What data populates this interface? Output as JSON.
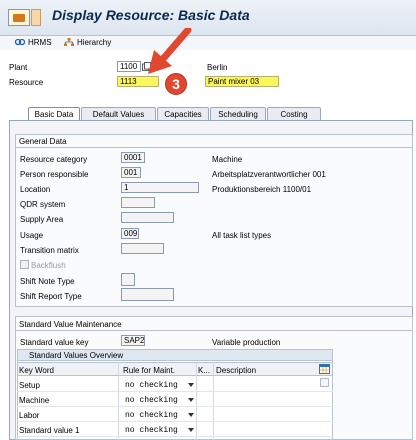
{
  "window": {
    "title": "Display Resource: Basic Data"
  },
  "toolbar": {
    "hrms_label": "HRMS",
    "hierarchy_label": "Hierarchy"
  },
  "header": {
    "plant_label": "Plant",
    "plant_value": "1100",
    "plant_desc": "Berlin",
    "resource_label": "Resource",
    "resource_value": "1113",
    "resource_desc": "Paint mixer 03"
  },
  "annotation": {
    "badge": "3"
  },
  "tabs": [
    {
      "label": "Basic Data",
      "active": true
    },
    {
      "label": "Default Values"
    },
    {
      "label": "Capacities"
    },
    {
      "label": "Scheduling"
    },
    {
      "label": "Costing"
    }
  ],
  "general_data": {
    "title": "General Data",
    "fields": [
      {
        "label": "Resource category",
        "value": "0001",
        "desc": "Machine"
      },
      {
        "label": "Person responsible",
        "value": "001",
        "desc": "Arbeitsplatzverantwortlicher 001"
      },
      {
        "label": "Location",
        "value": "1",
        "desc": "Produktionsbereich 1100/01"
      },
      {
        "label": "QDR system",
        "value": "",
        "desc": ""
      },
      {
        "label": "Supply Area",
        "value": "",
        "desc": ""
      },
      {
        "label": "Usage",
        "value": "009",
        "desc": "All task list types"
      },
      {
        "label": "Transition matrix",
        "value": "",
        "desc": ""
      },
      {
        "label": "Backflush",
        "value": "",
        "desc": ""
      },
      {
        "label": "Shift Note Type",
        "value": "",
        "desc": ""
      },
      {
        "label": "Shift Report Type",
        "value": "",
        "desc": ""
      }
    ]
  },
  "std_value_maint": {
    "title": "Standard Value Maintenance",
    "key_label": "Standard value key",
    "key_value": "SAP2",
    "key_desc": "Variable production",
    "overview_title": "Standard Values Overview",
    "columns": [
      "Key Word",
      "Rule for Maint.",
      "K...",
      "Description"
    ],
    "rows": [
      {
        "keyword": "Setup",
        "rule": "no checking"
      },
      {
        "keyword": "Machine",
        "rule": "no checking"
      },
      {
        "keyword": "Labor",
        "rule": "no checking"
      },
      {
        "keyword": "Standard value 1",
        "rule": "no checking"
      }
    ]
  },
  "colors": {
    "highlight": "#fbf75a",
    "arrow": "#e0482f",
    "title": "#0a2a52"
  }
}
